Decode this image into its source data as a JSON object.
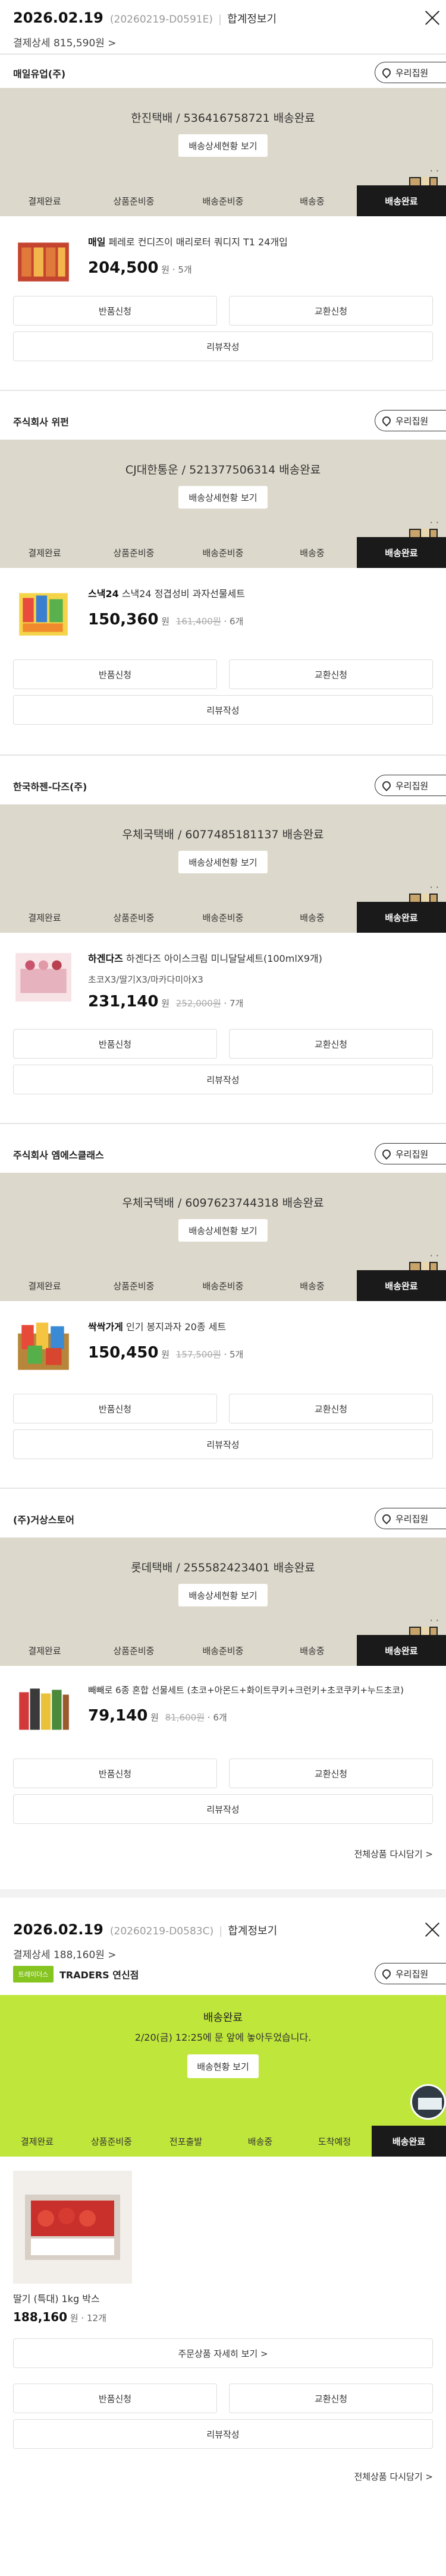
{
  "orders": [
    {
      "date": "2026.02.19",
      "number": "(20260219-D0591E)",
      "bill_label": "합계정보기",
      "pay_label": "결제상세 815,590원",
      "groups": [
        {
          "seller": "매일유업(주)",
          "store_btn": "우리집원",
          "tracking": "한진택배 / 536416758721 배송완료",
          "detail_btn": "배송상세현황 보기",
          "steps": [
            "결제완료",
            "상품준비중",
            "배송준비중",
            "배송중",
            "배송완료"
          ],
          "product": {
            "brand": "매일",
            "name": "페레로 컨디즈이 매리로터 쿼디지 T1 24개입",
            "price": "204,500",
            "won": "원",
            "orig": "",
            "qty": "· 5개"
          },
          "return_btn": "반품신청",
          "exchange_btn": "교환신청",
          "review_btn": "리뷰작성"
        },
        {
          "seller": "주식회사 위펀",
          "store_btn": "우리집원",
          "tracking": "CJ대한통운 / 521377506314 배송완료",
          "detail_btn": "배송상세현황 보기",
          "steps": [
            "결제완료",
            "상품준비중",
            "배송준비중",
            "배송중",
            "배송완료"
          ],
          "product": {
            "brand": "스낵24",
            "name": "스낵24 정겹성비 과자선물세트",
            "price": "150,360",
            "won": "원",
            "orig": "161,400원",
            "qty": "· 6개"
          },
          "return_btn": "반품신청",
          "exchange_btn": "교환신청",
          "review_btn": "리뷰작성"
        },
        {
          "seller": "한국하젠-다즈(주)",
          "store_btn": "우리집원",
          "tracking": "우체국택배 / 6077485181137 배송완료",
          "detail_btn": "배송상세현황 보기",
          "steps": [
            "결제완료",
            "상품준비중",
            "배송준비중",
            "배송중",
            "배송완료"
          ],
          "product": {
            "brand": "하겐다즈",
            "name": "하겐다즈 아이스크림 미니달달세트(100mlX9개)",
            "name2": "초코X3/딸기X3/마카다미아X3",
            "price": "231,140",
            "won": "원",
            "orig": "252,000원",
            "qty": "· 7개"
          },
          "return_btn": "반품신청",
          "exchange_btn": "교환신청",
          "review_btn": "리뷰작성"
        },
        {
          "seller": "주식회사 엠에스클래스",
          "store_btn": "우리집원",
          "tracking": "우체국택배 / 6097623744318 배송완료",
          "detail_btn": "배송상세현황 보기",
          "steps": [
            "결제완료",
            "상품준비중",
            "배송준비중",
            "배송중",
            "배송완료"
          ],
          "product": {
            "brand": "싹싹가게",
            "name": "인기 봉지과자 20종 세트",
            "price": "150,450",
            "won": "원",
            "orig": "157,500원",
            "qty": "· 5개"
          },
          "return_btn": "반품신청",
          "exchange_btn": "교환신청",
          "review_btn": "리뷰작성"
        },
        {
          "seller": "(주)거상스토어",
          "store_btn": "우리집원",
          "tracking": "롯데택배 / 255582423401 배송완료",
          "detail_btn": "배송상세현황 보기",
          "steps": [
            "결제완료",
            "상품준비중",
            "배송준비중",
            "배송중",
            "배송완료"
          ],
          "product": {
            "brand": "",
            "name": "빼빼로 6종 혼합 선물세트 (초코+아몬드+화이트쿠키+크런키+초코쿠키+누드초코)",
            "price": "79,140",
            "won": "원",
            "orig": "81,600원",
            "qty": "· 6개"
          },
          "return_btn": "반품신청",
          "exchange_btn": "교환신청",
          "review_btn": "리뷰작성"
        }
      ],
      "rebuy": "전체상품 다시담기 >"
    },
    {
      "date": "2026.02.19",
      "number": "(20260219-D0583C)",
      "bill_label": "합계정보기",
      "pay_label": "결제상세 188,160원",
      "seller": "TRADERS 연신점",
      "seller_logo": "트레이더스",
      "store_btn": "우리집원",
      "status_title": "배송완료",
      "status_sub": "2/20(금) 12:25에 문 앞에 놓아두었습니다.",
      "detail_btn": "배송현황 보기",
      "steps": [
        "결제완료",
        "상품준비중",
        "전포출발",
        "배송중",
        "도착예정",
        "배송완료"
      ],
      "product": {
        "name": "딸기 (특대) 1kg 박스",
        "price": "188,160",
        "won": "원",
        "qty": "· 12개"
      },
      "order_detail_btn": "주문상품 자세히 보기 >",
      "return_btn": "반품신청",
      "exchange_btn": "교환신청",
      "review_btn": "리뷰작성",
      "rebuy": "전체상품 다시담기 >"
    }
  ]
}
